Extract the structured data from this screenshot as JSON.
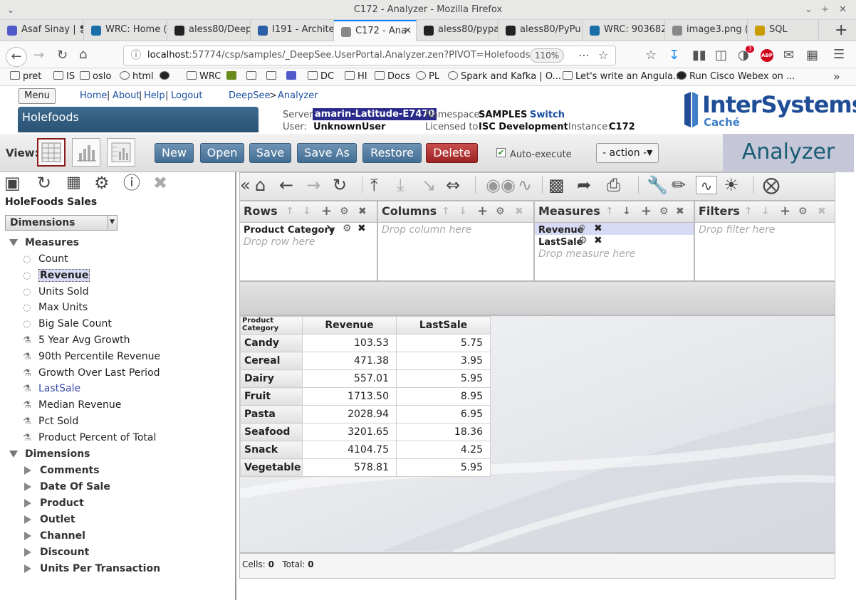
{
  "browser": {
    "window_title": "C172 - Analyzer - Mozilla Firefox",
    "tabs": [
      {
        "label": "Asaf Sinay | ❡",
        "icon": "teams-icon",
        "color": "#5059c9"
      },
      {
        "label": "WRC: Home (",
        "icon": "wrc-icon",
        "color": "#1a6fa8"
      },
      {
        "label": "aless80/Deep",
        "icon": "github-icon",
        "color": "#222222"
      },
      {
        "label": "I191 - Archite",
        "icon": "ir-icon",
        "color": "#2b5fa6"
      },
      {
        "label": "C172 - Ana",
        "icon": "loading-icon",
        "color": "#888888"
      },
      {
        "label": "aless80/pypa",
        "icon": "github-icon",
        "color": "#222222"
      },
      {
        "label": "aless80/PyPu",
        "icon": "github-icon",
        "color": "#222222"
      },
      {
        "label": "WRC: 903682",
        "icon": "wrc-icon",
        "color": "#1a6fa8"
      },
      {
        "label": "image3.png (",
        "icon": "image-icon",
        "color": "#888888"
      },
      {
        "label": "SQL",
        "icon": "sql-icon",
        "color": "#c89b00"
      }
    ],
    "url_host": "localhost",
    "url_rest": ":57774/csp/samples/_DeepSee.UserPortal.Analyzer.zen?PIVOT=Holefoods.pivot",
    "zoom": "110%",
    "notification_count": "3",
    "bookmarks": [
      "pret",
      "IS",
      "oslo",
      "html",
      "WRC",
      "DC",
      "HI",
      "Docs",
      "PL",
      "Spark and Kafka | O...",
      "Let's write an Angula...",
      "Run Cisco Webex on ..."
    ]
  },
  "header": {
    "menu_label": "Menu",
    "links": [
      "Home",
      "About",
      "Help",
      "Logout"
    ],
    "breadcrumb": {
      "root": "DeepSee",
      "sep": ">",
      "current": "Analyzer"
    },
    "banner": "Holefoods",
    "server_label": "Server:",
    "server_value": "amarin-Latitude-E7470",
    "user_label": "User:",
    "user_value": "UnknownUser",
    "namespace_label": "Namespace:",
    "namespace_value": "SAMPLES",
    "switch_label": "Switch",
    "licensed_label": "Licensed to:",
    "licensed_value": "ISC Development",
    "instance_label": "Instance:",
    "instance_value": "C172",
    "logo_main": "InterSystems",
    "logo_sub": "Caché",
    "brand": "Analyzer"
  },
  "viewbar": {
    "view_label": "View:",
    "buttons": [
      "New",
      "Open",
      "Save",
      "Save As",
      "Restore",
      "Delete"
    ],
    "auto_execute_label": "Auto-execute",
    "action_label": "- action -"
  },
  "left": {
    "cube_title": "HoleFoods Sales",
    "select_value": "Dimensions",
    "measures_folder": "Measures",
    "measures": [
      {
        "label": "Count",
        "kind": "measure"
      },
      {
        "label": "Revenue",
        "kind": "measure"
      },
      {
        "label": "Units Sold",
        "kind": "measure"
      },
      {
        "label": "Max Units",
        "kind": "measure"
      },
      {
        "label": "Big Sale Count",
        "kind": "measure"
      },
      {
        "label": "5 Year Avg Growth",
        "kind": "calc"
      },
      {
        "label": "90th Percentile Revenue",
        "kind": "calc"
      },
      {
        "label": "Growth Over Last Period",
        "kind": "calc"
      },
      {
        "label": "LastSale",
        "kind": "calc"
      },
      {
        "label": "Median Revenue",
        "kind": "calc"
      },
      {
        "label": "Pct Sold",
        "kind": "calc"
      },
      {
        "label": "Product Percent of Total",
        "kind": "calc"
      }
    ],
    "dimensions_folder": "Dimensions",
    "dimensions": [
      "Comments",
      "Date Of Sale",
      "Product",
      "Outlet",
      "Channel",
      "Discount",
      "Units Per Transaction"
    ]
  },
  "panes": {
    "rows": {
      "title": "Rows",
      "chip": "Product Category",
      "drop": "Drop row here"
    },
    "columns": {
      "title": "Columns",
      "drop": "Drop column here"
    },
    "measures": {
      "title": "Measures",
      "chips": [
        "Revenue",
        "LastSale"
      ],
      "drop": "Drop measure here"
    },
    "filters": {
      "title": "Filters",
      "drop": "Drop filter here"
    }
  },
  "pivot": {
    "corner": "Product Category",
    "columns": [
      "Revenue",
      "LastSale"
    ],
    "rows": [
      {
        "label": "Candy",
        "values": [
          "103.53",
          "5.75"
        ]
      },
      {
        "label": "Cereal",
        "values": [
          "471.38",
          "3.95"
        ]
      },
      {
        "label": "Dairy",
        "values": [
          "557.01",
          "5.95"
        ]
      },
      {
        "label": "Fruit",
        "values": [
          "1713.50",
          "8.95"
        ]
      },
      {
        "label": "Pasta",
        "values": [
          "2028.94",
          "6.95"
        ]
      },
      {
        "label": "Seafood",
        "values": [
          "3201.65",
          "18.36"
        ]
      },
      {
        "label": "Snack",
        "values": [
          "4104.75",
          "4.25"
        ]
      },
      {
        "label": "Vegetable",
        "values": [
          "578.81",
          "5.95"
        ]
      }
    ]
  },
  "footer": {
    "cells_label": "Cells:",
    "cells_value": "0",
    "total_label": "Total:",
    "total_value": "0"
  }
}
